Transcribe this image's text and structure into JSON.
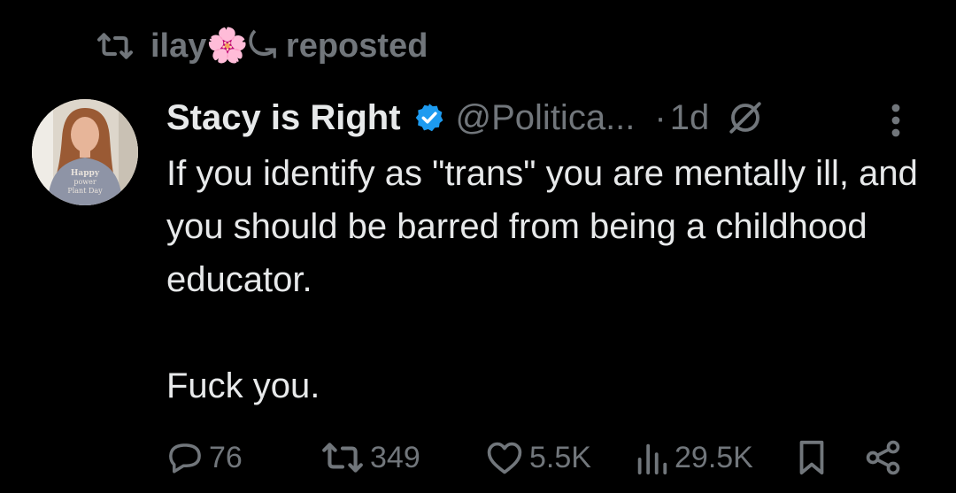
{
  "repost": {
    "user_name": "ilay🌸⤿",
    "label": "reposted",
    "icon": "repost-icon"
  },
  "tweet": {
    "author_name": "Stacy is Right",
    "verified": true,
    "handle": "@Politica...",
    "separator": "·",
    "time": "1d",
    "avatar_shirt_text": [
      "Happy",
      "power",
      "Plant Day"
    ],
    "text": "If you identify as \"trans\" you are mentally ill, and you should be barred from being a childhood educator.\n\nFuck you."
  },
  "actions": {
    "replies": "76",
    "reposts": "349",
    "likes": "5.5K",
    "views": "29.5K"
  },
  "colors": {
    "background": "#000000",
    "text": "#e7e9ea",
    "muted": "#71767b",
    "verified_blue": "#1d9bf0"
  }
}
